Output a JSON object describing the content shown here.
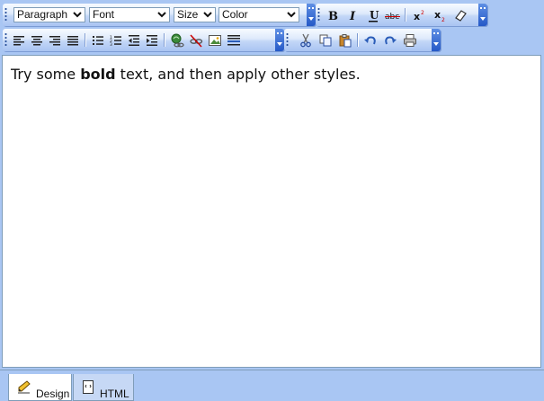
{
  "toolbar1": {
    "format_select": "Paragraph",
    "font_select": "Font",
    "size_select": "Size",
    "color_select": "Color",
    "buttons": [
      "bold-icon",
      "italic-icon",
      "underline-icon",
      "strikethrough-icon",
      "superscript-icon",
      "subscript-icon",
      "eraser-icon"
    ]
  },
  "toolbar2": {
    "buttons": [
      "align-left-icon",
      "align-center-icon",
      "align-right-icon",
      "justify-icon",
      "bullet-list-icon",
      "numbered-list-icon",
      "outdent-icon",
      "indent-icon",
      "link-icon",
      "unlink-icon",
      "image-icon",
      "horizontal-rule-icon",
      "cut-icon",
      "copy-icon",
      "paste-icon",
      "undo-icon",
      "redo-icon",
      "print-icon"
    ]
  },
  "editor": {
    "text_before": "Try some ",
    "text_bold": "bold",
    "text_after": " text, and then apply other styles."
  },
  "tabs": {
    "design_label": "Design",
    "html_label": "HTML"
  },
  "colors": {
    "toolbar_bg": "#a9c6f3",
    "chevron": "#2559c7",
    "border": "#7f9db9"
  }
}
